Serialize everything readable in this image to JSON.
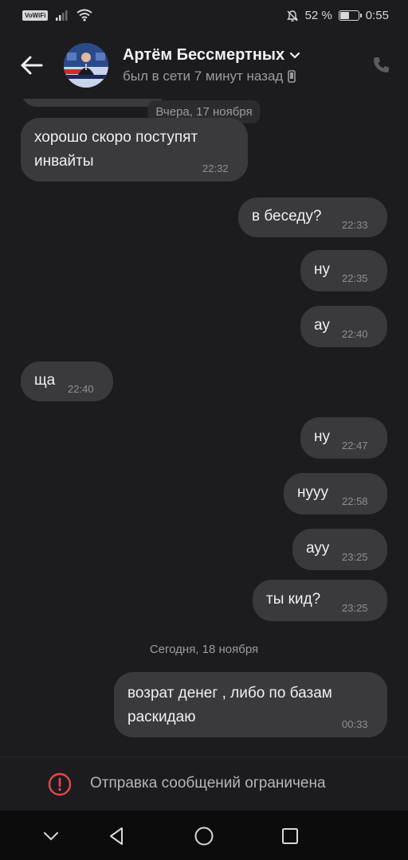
{
  "status_bar": {
    "volte_label": "VoWiFi",
    "battery_text": "52 %",
    "battery_level": 0.52,
    "time": "0:55"
  },
  "header": {
    "contact_name": "Артём Бессмертных",
    "last_seen": "был в сети 7 минут назад"
  },
  "messages": {
    "date_yesterday": "Вчера, 17 ноября",
    "date_today": "Сегодня, 18 ноября",
    "m1": {
      "text_line1": "хорошо скоро поступят",
      "text_line2": "инвайты",
      "time": "22:32"
    },
    "m2": {
      "text": "в беседу?",
      "time": "22:33"
    },
    "m3": {
      "text": "ну",
      "time": "22:35"
    },
    "m4": {
      "text": "ау",
      "time": "22:40"
    },
    "m5": {
      "text": "ща",
      "time": "22:40"
    },
    "m6": {
      "text": "ну",
      "time": "22:47"
    },
    "m7": {
      "text": "нууу",
      "time": "22:58"
    },
    "m8": {
      "text": "ауу",
      "time": "23:25"
    },
    "m9": {
      "text": "ты кид?",
      "time": "23:25"
    },
    "m10": {
      "text_line1": "возрат денег , либо по базам",
      "text_line2": "раскидаю",
      "time": "00:33"
    }
  },
  "composer": {
    "restriction_text": "Отправка сообщений ограничена"
  },
  "icons": {
    "back": "arrow-left-icon",
    "chevron": "chevron-down-icon",
    "phone": "phone-icon",
    "device": "mobile-device-icon",
    "warning": "warning-circle-icon"
  },
  "colors": {
    "background": "#1c1c1e",
    "bubble": "#3a3a3c",
    "warning": "#e5484d"
  }
}
